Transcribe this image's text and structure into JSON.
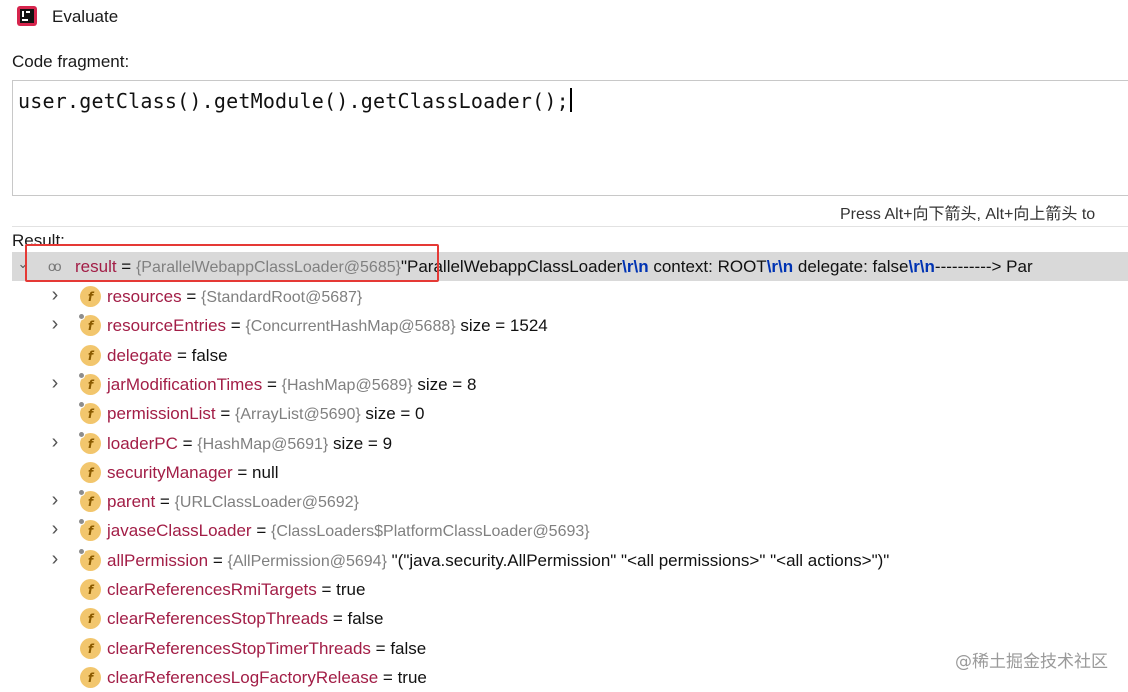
{
  "window": {
    "title": "Evaluate"
  },
  "code_fragment": {
    "label": "Code fragment:",
    "value": "user.getClass().getModule().getClassLoader();"
  },
  "hint": "Press Alt+向下箭头, Alt+向上箭头 to",
  "result": {
    "label": "Result:",
    "root": {
      "name": "result",
      "eq": " = ",
      "ref": "{ParallelWebappClassLoader@5685}",
      "segments": [
        {
          "t": "\"ParallelWebappClassLoader",
          "k": "plain"
        },
        {
          "t": "\\r\\n",
          "k": "esc"
        },
        {
          "t": "  context: ROOT",
          "k": "plain"
        },
        {
          "t": "\\r\\n",
          "k": "esc"
        },
        {
          "t": "  delegate: false",
          "k": "plain"
        },
        {
          "t": "\\r\\n",
          "k": "esc"
        },
        {
          "t": "----------> Par",
          "k": "plain"
        }
      ]
    },
    "fields": [
      {
        "name": "resources",
        "ref": "{StandardRoot@5687}",
        "extra": "",
        "expandable": true,
        "locked": false
      },
      {
        "name": "resourceEntries",
        "ref": "{ConcurrentHashMap@5688}",
        "extra": "size = 1524",
        "expandable": true,
        "locked": true
      },
      {
        "name": "delegate",
        "ref": "",
        "extra": "false",
        "expandable": false,
        "locked": false
      },
      {
        "name": "jarModificationTimes",
        "ref": "{HashMap@5689}",
        "extra": "size = 8",
        "expandable": true,
        "locked": true
      },
      {
        "name": "permissionList",
        "ref": "{ArrayList@5690}",
        "extra": "size = 0",
        "expandable": false,
        "locked": true
      },
      {
        "name": "loaderPC",
        "ref": "{HashMap@5691}",
        "extra": "size = 9",
        "expandable": true,
        "locked": true
      },
      {
        "name": "securityManager",
        "ref": "",
        "extra": "null",
        "expandable": false,
        "locked": false
      },
      {
        "name": "parent",
        "ref": "{URLClassLoader@5692}",
        "extra": "",
        "expandable": true,
        "locked": true
      },
      {
        "name": "javaseClassLoader",
        "ref": "{ClassLoaders$PlatformClassLoader@5693}",
        "extra": "",
        "expandable": true,
        "locked": true
      },
      {
        "name": "allPermission",
        "ref": "{AllPermission@5694}",
        "extra": "\"(\"java.security.AllPermission\" \"<all permissions>\" \"<all actions>\")\"",
        "expandable": true,
        "locked": true
      },
      {
        "name": "clearReferencesRmiTargets",
        "ref": "",
        "extra": "true",
        "expandable": false,
        "locked": false
      },
      {
        "name": "clearReferencesStopThreads",
        "ref": "",
        "extra": "false",
        "expandable": false,
        "locked": false
      },
      {
        "name": "clearReferencesStopTimerThreads",
        "ref": "",
        "extra": "false",
        "expandable": false,
        "locked": false
      },
      {
        "name": "clearReferencesLogFactoryRelease",
        "ref": "",
        "extra": "true",
        "expandable": false,
        "locked": false
      }
    ]
  },
  "watermark": "@稀土掘金技术社区",
  "icons": {
    "app": "intellij-icon",
    "field": "field-icon",
    "expand": "chevron-right-icon",
    "collapse": "chevron-down-icon",
    "watch": "glasses-icon"
  },
  "colors": {
    "field_name": "#a21d46",
    "object_ref": "#808080",
    "escape": "#0033b3",
    "selected_row": "#d9d9d9",
    "highlight_box": "#e53935"
  }
}
